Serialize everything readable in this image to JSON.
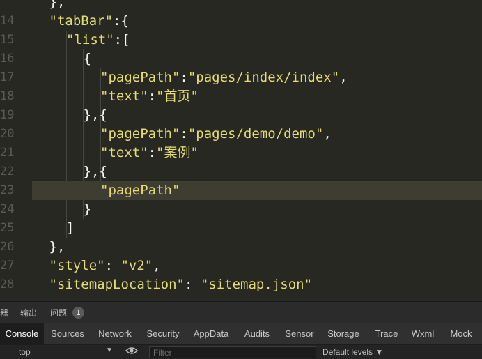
{
  "editor": {
    "gutter": [
      "",
      "14",
      "15",
      "16",
      "17",
      "18",
      "19",
      "20",
      "21",
      "22",
      "23",
      "24",
      "25",
      "26",
      "27",
      "28"
    ],
    "lines": [
      {
        "indent": 1,
        "parts": [
          {
            "t": "},",
            "c": "k"
          }
        ]
      },
      {
        "indent": 1,
        "parts": [
          {
            "t": "\"tabBar\"",
            "c": "s"
          },
          {
            "t": ":{",
            "c": "k"
          }
        ]
      },
      {
        "indent": 2,
        "parts": [
          {
            "t": "\"list\"",
            "c": "s"
          },
          {
            "t": ":[",
            "c": "k"
          }
        ]
      },
      {
        "indent": 3,
        "parts": [
          {
            "t": "{",
            "c": "k"
          }
        ]
      },
      {
        "indent": 4,
        "parts": [
          {
            "t": "\"pagePath\"",
            "c": "s"
          },
          {
            "t": ":",
            "c": "k"
          },
          {
            "t": "\"pages/index/index\"",
            "c": "s"
          },
          {
            "t": ",",
            "c": "k"
          }
        ]
      },
      {
        "indent": 4,
        "parts": [
          {
            "t": "\"text\"",
            "c": "s"
          },
          {
            "t": ":",
            "c": "k"
          },
          {
            "t": "\"首页\"",
            "c": "s"
          }
        ]
      },
      {
        "indent": 3,
        "parts": [
          {
            "t": "},{",
            "c": "k"
          }
        ]
      },
      {
        "indent": 4,
        "parts": [
          {
            "t": "\"pagePath\"",
            "c": "s"
          },
          {
            "t": ":",
            "c": "k"
          },
          {
            "t": "\"pages/demo/demo\"",
            "c": "s"
          },
          {
            "t": ",",
            "c": "k"
          }
        ]
      },
      {
        "indent": 4,
        "parts": [
          {
            "t": "\"text\"",
            "c": "s"
          },
          {
            "t": ":",
            "c": "k"
          },
          {
            "t": "\"案例\"",
            "c": "s"
          }
        ]
      },
      {
        "indent": 3,
        "parts": [
          {
            "t": "},{",
            "c": "k"
          }
        ]
      },
      {
        "indent": 4,
        "parts": [
          {
            "t": "\"pagePath\"",
            "c": "s"
          }
        ]
      },
      {
        "indent": 3,
        "parts": [
          {
            "t": "}",
            "c": "k"
          }
        ]
      },
      {
        "indent": 2,
        "parts": [
          {
            "t": "]",
            "c": "k"
          }
        ]
      },
      {
        "indent": 1,
        "parts": [
          {
            "t": "},",
            "c": "k"
          }
        ]
      },
      {
        "indent": 1,
        "parts": [
          {
            "t": "\"style\"",
            "c": "s"
          },
          {
            "t": ": ",
            "c": "k"
          },
          {
            "t": "\"v2\"",
            "c": "s"
          },
          {
            "t": ",",
            "c": "k"
          }
        ]
      },
      {
        "indent": 1,
        "parts": [
          {
            "t": "\"sitemapLocation\"",
            "c": "s"
          },
          {
            "t": ": ",
            "c": "k"
          },
          {
            "t": "\"sitemap.json\"",
            "c": "s"
          }
        ]
      }
    ],
    "active_line": 10
  },
  "panel_tabs": {
    "debugger": "器",
    "output": "输出",
    "problems": "问题",
    "problems_count": "1"
  },
  "devtools_tabs": [
    "Console",
    "Sources",
    "Network",
    "Security",
    "AppData",
    "Audits",
    "Sensor",
    "Storage",
    "Trace",
    "Wxml",
    "Mock"
  ],
  "devtools_selected": "Console",
  "console_bar": {
    "context": "top",
    "filter_placeholder": "Filter",
    "levels": "Default levels"
  },
  "colors": {
    "editor_bg": "#272822",
    "string": "#e6db74",
    "active_line": "#3e3d32"
  }
}
